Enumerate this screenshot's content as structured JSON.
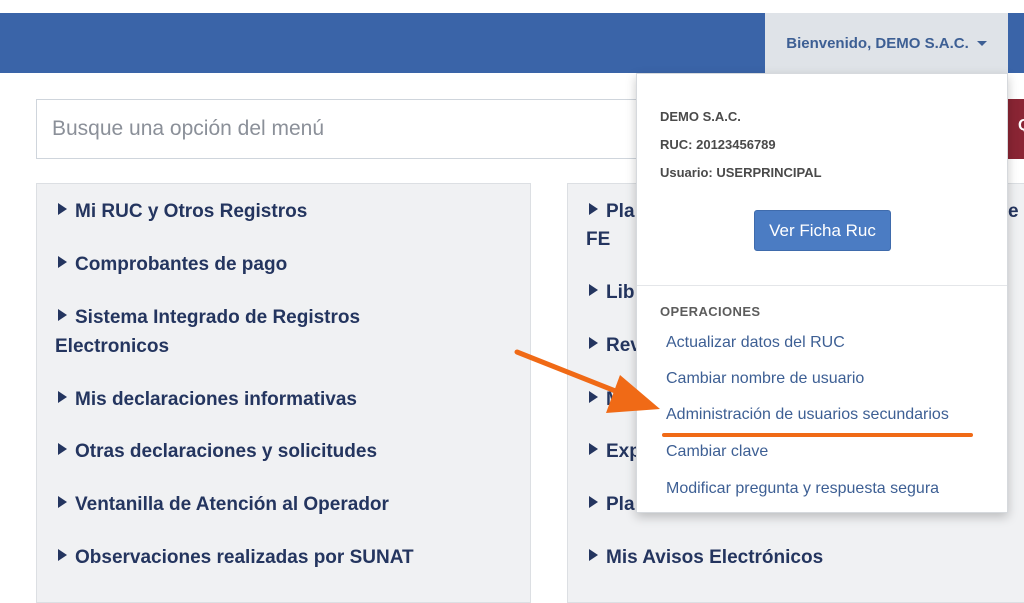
{
  "header": {
    "user_greeting": "Bienvenido, DEMO S.A.C."
  },
  "search": {
    "placeholder": "Busque una opción del menú",
    "button_glyph": "Q"
  },
  "menu_left": [
    {
      "label": "Mi RUC y Otros Registros"
    },
    {
      "label": "Comprobantes de pago"
    },
    {
      "label": "Sistema Integrado de Registros",
      "label_line2": "Electronicos"
    },
    {
      "label": "Mis declaraciones informativas"
    },
    {
      "label": "Otras declaraciones y solicitudes"
    },
    {
      "label": "Ventanilla de Atención al Operador"
    },
    {
      "label": "Observaciones realizadas por SUNAT"
    }
  ],
  "menu_right": [
    {
      "label": "Pla",
      "label_cut": "e I",
      "label_line2": "FE"
    },
    {
      "label": "Lib"
    },
    {
      "label": "Rev"
    },
    {
      "label": "Mi"
    },
    {
      "label": "Exp"
    },
    {
      "label": "Pla"
    },
    {
      "label": "Mis Avisos Electrónicos"
    }
  ],
  "dropdown": {
    "company": "DEMO S.A.C.",
    "ruc": "RUC: 20123456789",
    "usuario": "Usuario: USERPRINCIPAL",
    "ver_ficha_label": "Ver Ficha Ruc",
    "operations_header": "OPERACIONES",
    "operations": [
      "Actualizar datos del RUC",
      "Cambiar nombre de usuario",
      "Administración de usuarios secundarios",
      "Cambiar clave",
      "Modificar pregunta y respuesta segura"
    ]
  },
  "colors": {
    "navbar": "#3a64a8",
    "link": "#3d5f94",
    "menu_text": "#24355f",
    "annotation": "#f06a16",
    "search_button": "#8a2534"
  }
}
